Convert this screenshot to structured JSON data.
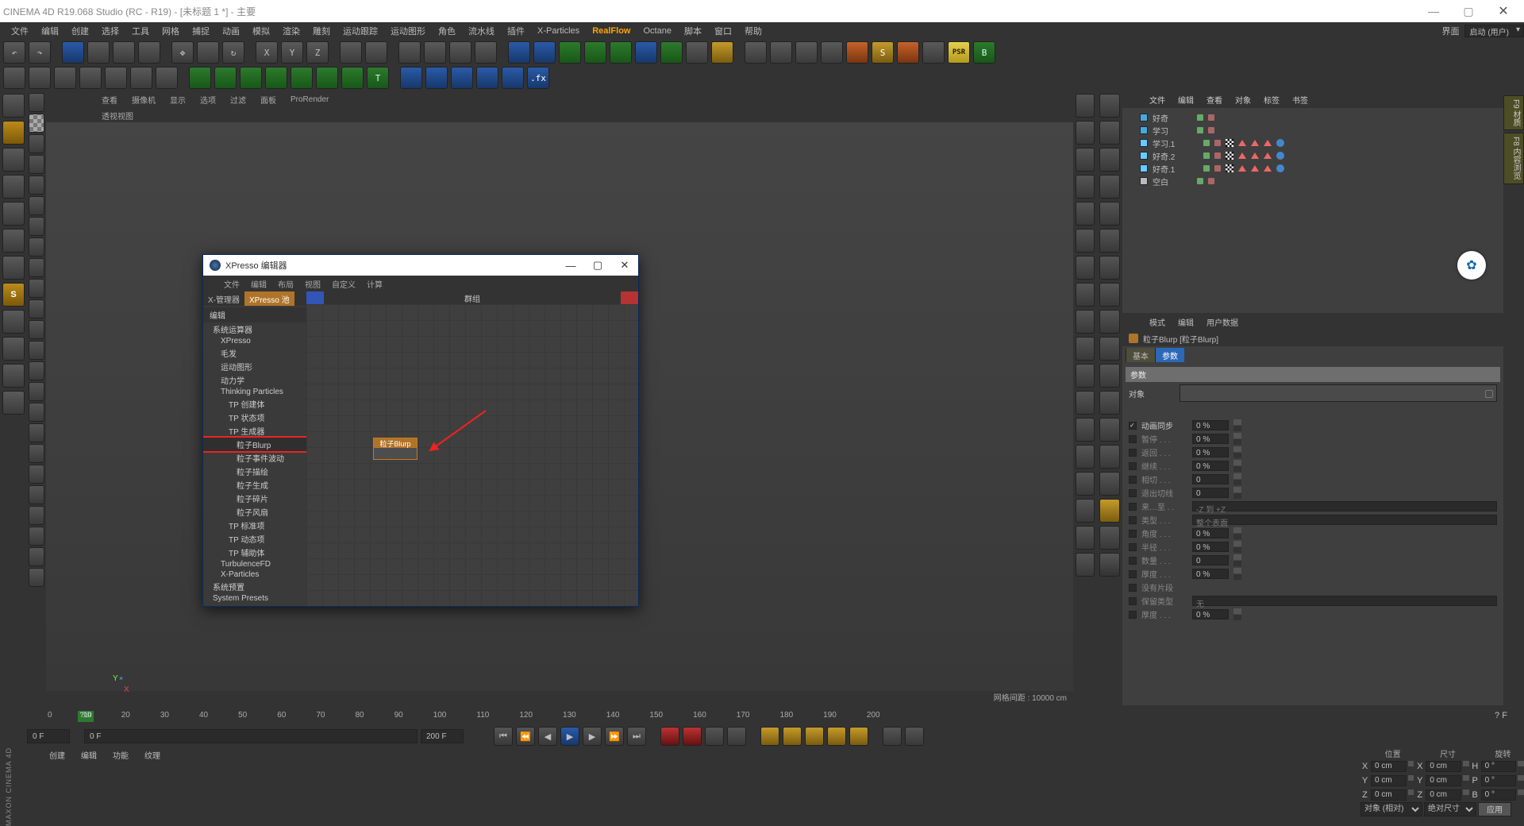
{
  "window": {
    "app_title": "CINEMA 4D R19.068 Studio (RC - R19) - [未标题 1 *] - 主要",
    "sys_min": "—",
    "sys_max": "▢",
    "sys_close": "✕"
  },
  "menubar": {
    "items": [
      "文件",
      "编辑",
      "创建",
      "选择",
      "工具",
      "网格",
      "捕捉",
      "动画",
      "模拟",
      "渲染",
      "雕刻",
      "运动跟踪",
      "运动图形",
      "角色",
      "流水线",
      "插件",
      "X-Particles",
      "RealFlow",
      "Octane",
      "脚本",
      "窗口",
      "帮助"
    ],
    "layout_label": "界面",
    "layout_value": "启动 (用户)"
  },
  "viewport": {
    "sub_menu": [
      "查看",
      "摄像机",
      "显示",
      "选项",
      "过滤",
      "面板",
      "ProRender"
    ],
    "title": "透视视图",
    "footer": "网格间距 : 10000 cm"
  },
  "object_manager": {
    "tabs": [
      "文件",
      "编辑",
      "查看",
      "对象",
      "标签",
      "书签"
    ],
    "rows": [
      {
        "icon": "T",
        "name": "好奇"
      },
      {
        "icon": "T",
        "name": "学习"
      },
      {
        "icon": "人",
        "name": "学习.1",
        "tags": 3
      },
      {
        "icon": "人",
        "name": "好奇.2",
        "tags": 3
      },
      {
        "icon": "人",
        "name": "好奇.1",
        "tags": 3
      },
      {
        "icon": "L",
        "name": "空白"
      }
    ]
  },
  "attribute": {
    "tabs_hd": [
      "模式",
      "编辑",
      "用户数据"
    ],
    "title": "粒子Blurp [粒子Blurp]",
    "tabs": [
      "基本",
      "参数"
    ],
    "section": "参数",
    "drop_label": "对象",
    "rows": [
      {
        "lbl": "动画同步",
        "val": "0 %",
        "en": true,
        "cb": true
      },
      {
        "lbl": "暂停 . . .",
        "val": "0 %"
      },
      {
        "lbl": "返回 . . .",
        "val": "0 %"
      },
      {
        "lbl": "继续 . . .",
        "val": "0 %"
      },
      {
        "lbl": "相切 . . .",
        "val": "0"
      },
      {
        "lbl": "退出切线",
        "val": "0"
      },
      {
        "lbl": "来…至 . .",
        "dd": "-Z 到 +Z"
      },
      {
        "lbl": "类型 . . .",
        "dd": "整个表面"
      },
      {
        "lbl": "角度 . . .",
        "val": "0 %"
      },
      {
        "lbl": "半径 . . .",
        "val": "0 %"
      },
      {
        "lbl": "数量 . . .",
        "val": "0"
      },
      {
        "lbl": "厚度 . . .",
        "val": "0 %"
      },
      {
        "lbl": "没有片段",
        "cb": false
      },
      {
        "lbl": "保留类型",
        "dd": "无"
      },
      {
        "lbl": "厚度 . . .",
        "val": "0 %"
      }
    ]
  },
  "timeline": {
    "start_field": "0 F",
    "cur_field": "0 F",
    "end_field": "200 F",
    "marks": [
      "0",
      "10",
      "20",
      "30",
      "40",
      "50",
      "60",
      "70",
      "80",
      "90",
      "100",
      "110",
      "120",
      "130",
      "140",
      "150",
      "160",
      "170",
      "180",
      "190",
      "200"
    ],
    "cursor": "?10",
    "right_status": "? F",
    "second_menu": [
      "创建",
      "编辑",
      "功能",
      "纹理"
    ]
  },
  "coords": {
    "headers": [
      "位置",
      "尺寸",
      "旋转"
    ],
    "axes": [
      "X",
      "Y",
      "Z"
    ],
    "pos": [
      "0 cm",
      "0 cm",
      "0 cm"
    ],
    "size": [
      "0 cm",
      "0 cm",
      "0 cm"
    ],
    "rot": [
      "0 °",
      "0 °",
      "0 °"
    ],
    "dd1": "对象 (相对)",
    "dd2": "绝对尺寸",
    "btn": "应用",
    "sym": [
      "X",
      "Y",
      "Z"
    ],
    "mid": [
      "H",
      "P",
      "B"
    ]
  },
  "xpresso": {
    "title": "XPresso 编辑器",
    "menu": [
      "文件",
      "编辑",
      "布局",
      "视图",
      "自定义",
      "计算"
    ],
    "left_tab_a": "X-管理器",
    "left_tab_b": "XPresso 池",
    "tree_header": "编辑",
    "tree": [
      {
        "t": "系统运算器",
        "d": 0
      },
      {
        "t": "XPresso",
        "d": 1
      },
      {
        "t": "毛发",
        "d": 1
      },
      {
        "t": "运动图形",
        "d": 1
      },
      {
        "t": "动力学",
        "d": 1
      },
      {
        "t": "Thinking Particles",
        "d": 1
      },
      {
        "t": "TP 创建体",
        "d": 2
      },
      {
        "t": "TP 状态项",
        "d": 2
      },
      {
        "t": "TP 生成器",
        "d": 2
      },
      {
        "t": "粒子Blurp",
        "d": 3,
        "boxed": true
      },
      {
        "t": "粒子事件波动",
        "d": 3
      },
      {
        "t": "粒子描绘",
        "d": 3
      },
      {
        "t": "粒子生成",
        "d": 3
      },
      {
        "t": "粒子碎片",
        "d": 3
      },
      {
        "t": "粒子风扇",
        "d": 3
      },
      {
        "t": "TP 标准项",
        "d": 2
      },
      {
        "t": "TP 动态项",
        "d": 2
      },
      {
        "t": "TP 辅助体",
        "d": 2
      },
      {
        "t": "TurbulenceFD",
        "d": 1
      },
      {
        "t": "X-Particles",
        "d": 1
      },
      {
        "t": "系统预置",
        "d": 0
      },
      {
        "t": "System Presets",
        "d": 0
      }
    ],
    "canvas_hd": "群组",
    "node_label": "粒子Blurp"
  },
  "side_tabs": {
    "a": "F9 材质",
    "b": "F8 内容浏览"
  }
}
